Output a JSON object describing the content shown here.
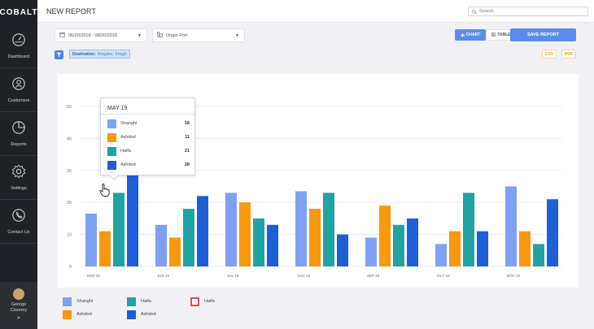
{
  "app": {
    "logo": "COBALT"
  },
  "sidebar": {
    "items": [
      {
        "label": "Dashboard",
        "icon": "dashboard-icon"
      },
      {
        "label": "Customers",
        "icon": "customers-icon"
      },
      {
        "label": "Reports",
        "icon": "reports-icon"
      },
      {
        "label": "Settings",
        "icon": "settings-icon"
      },
      {
        "label": "Contact Us",
        "icon": "contact-icon"
      }
    ],
    "user": {
      "first": "George",
      "last": "Clooney",
      "expand": "»"
    }
  },
  "header": {
    "title": "NEW REPORT",
    "search_placeholder": "Search"
  },
  "toolbar": {
    "date_range": "06/20/2018 - 08/20/2018",
    "port": "Origin Port",
    "chart_label": "CHART",
    "table_label": "TABLE",
    "save_label": "SAVE REPORT",
    "filter_key": "Destination:",
    "filter_value": "Ningabo, Shagh",
    "csv": "CSV",
    "pdf": "PDF"
  },
  "colors": {
    "shanghai": "#7fa0f4",
    "ashdod_orange": "#f7980d",
    "haifa": "#1fa3a3",
    "ashdod_blue": "#1d5fd6",
    "accent": "#5b8cea"
  },
  "tooltip": {
    "title": "MAY 19",
    "rows": [
      {
        "name": "Shanghi",
        "value": "18",
        "color": "#7fa0f4"
      },
      {
        "name": "Ashdod",
        "value": "11",
        "color": "#f7980d"
      },
      {
        "name": "Haifa",
        "value": "21",
        "color": "#1fa3a3"
      },
      {
        "name": "Ashdod",
        "value": "28",
        "color": "#1d5fd6"
      }
    ]
  },
  "legend": [
    {
      "label": "Shanghi",
      "color": "#7fa0f4",
      "outline": false
    },
    {
      "label": "Haifa",
      "color": "#1fa3a3",
      "outline": false
    },
    {
      "label": "Haifa",
      "color": "#e84a4a",
      "outline": true
    },
    {
      "label": "Ashdod",
      "color": "#f7980d",
      "outline": false
    },
    {
      "label": "Ashdod",
      "color": "#1d5fd6",
      "outline": false
    }
  ],
  "chart_data": {
    "type": "bar",
    "categories": [
      "MAY 19",
      "JUN 19",
      "JUL 19",
      "AUG 19",
      "SEP 19",
      "OCT 19",
      "NOV 19"
    ],
    "series": [
      {
        "name": "Shanghi",
        "values": [
          16.5,
          13,
          23,
          23.5,
          9,
          7,
          25
        ]
      },
      {
        "name": "Ashdod",
        "values": [
          11,
          9,
          20,
          18,
          19,
          11,
          11
        ]
      },
      {
        "name": "Haifa",
        "values": [
          23,
          18,
          15,
          23,
          13,
          23,
          7
        ]
      },
      {
        "name": "Ashdod",
        "values": [
          28.5,
          22,
          13,
          10,
          15,
          11,
          21
        ]
      }
    ],
    "yticks": [
      0,
      10,
      20,
      30,
      40,
      50
    ],
    "ylim": [
      0,
      50
    ],
    "grid": true
  }
}
